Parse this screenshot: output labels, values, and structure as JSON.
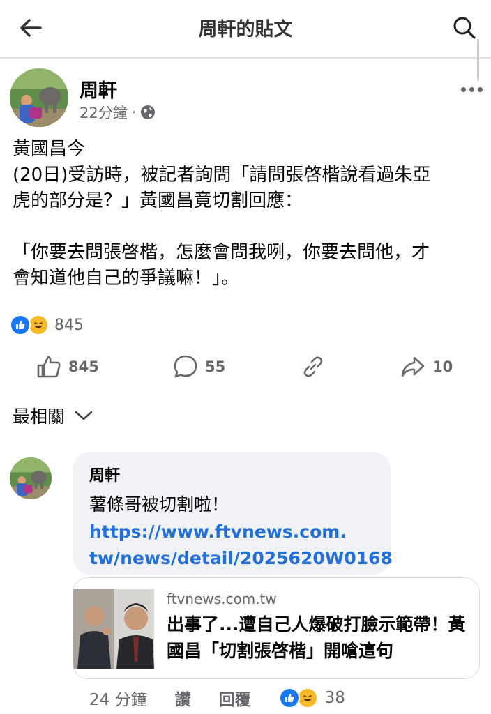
{
  "header": {
    "title": "周軒的貼文"
  },
  "post": {
    "author": "周軒",
    "time": "22分鐘",
    "separator": "·",
    "text": "黃國昌今\n(20日)受訪時，被記者詢問「請問張啓楷說看過朱亞\n虎的部分是？」黃國昌竟切割回應：\n\n「你要去問張啓楷，怎麼會問我咧，你要去問他，才\n會知道他自己的爭議嘛！」。",
    "reaction_count": "845",
    "actions": {
      "like_count": "845",
      "comment_count": "55",
      "share_count": "10"
    }
  },
  "sort": {
    "label": "最相關"
  },
  "comment": {
    "author": "周軒",
    "text": "薯條哥被切割啦！",
    "link_line1": "https://www.ftvnews.com.",
    "link_line2": "tw/news/detail/2025620W0168",
    "preview": {
      "domain": "ftvnews.com.tw",
      "title": "出事了...遭自己人爆破打臉示範帶！黃國昌「切割張啓楷」開嗆這句"
    },
    "time": "24 分鐘",
    "like_label": "讚",
    "reply_label": "回覆",
    "reaction_count": "38"
  },
  "colors": {
    "facebook_blue": "#1877f2",
    "link_blue": "#216fdb",
    "secondary_text": "#65676b",
    "bubble_bg": "#f0f2f5"
  },
  "icons": [
    "back-arrow-icon",
    "search-icon",
    "globe-icon",
    "more-icon",
    "like-icon",
    "haha-icon",
    "comment-icon",
    "link-icon",
    "share-icon",
    "chevron-down-icon"
  ]
}
